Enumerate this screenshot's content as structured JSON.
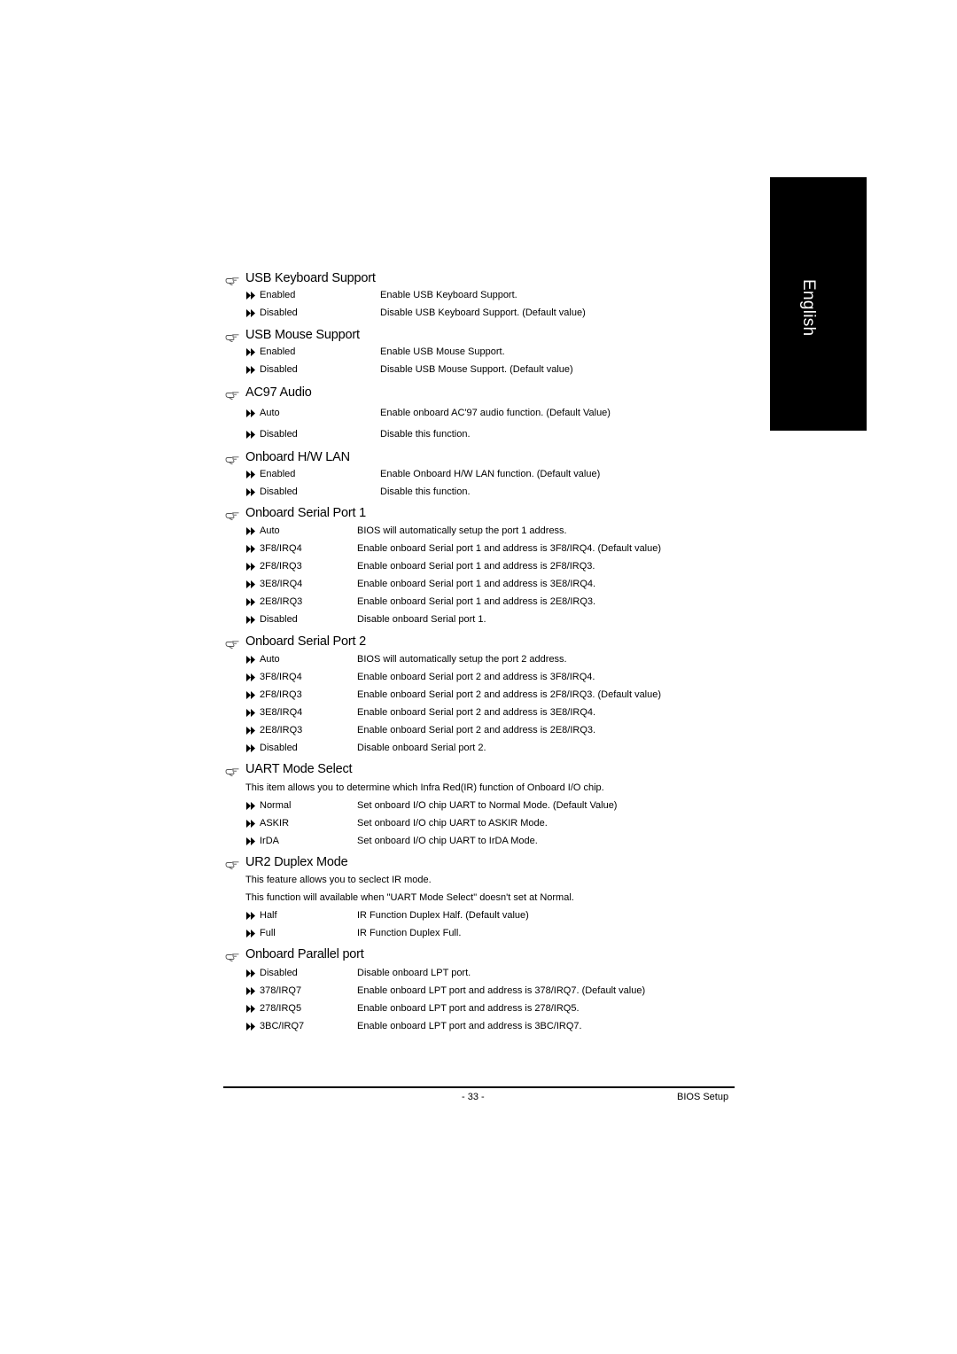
{
  "side_tab": {
    "label": "English"
  },
  "sections": [
    {
      "title": "USB Keyboard Support",
      "notes": [],
      "options": [
        {
          "name": "Enabled",
          "desc": "Enable USB Keyboard Support."
        },
        {
          "name": "Disabled",
          "desc": "Disable USB Keyboard Support. (Default value)"
        }
      ]
    },
    {
      "title": "USB Mouse Support",
      "notes": [],
      "options": [
        {
          "name": "Enabled",
          "desc": "Enable USB Mouse Support."
        },
        {
          "name": "Disabled",
          "desc": "Disable USB Mouse Support. (Default value)"
        }
      ]
    },
    {
      "title": "AC97 Audio",
      "notes": [],
      "options": [
        {
          "name": "Auto",
          "desc": "Enable onboard AC'97 audio function. (Default Value)"
        },
        {
          "name": "Disabled",
          "desc": "Disable this function."
        }
      ]
    },
    {
      "title": "Onboard H/W LAN",
      "notes": [],
      "options": [
        {
          "name": "Enabled",
          "desc": "Enable Onboard H/W LAN function. (Default value)"
        },
        {
          "name": "Disabled",
          "desc": "Disable this function."
        }
      ]
    },
    {
      "title": "Onboard Serial Port 1",
      "notes": [],
      "options": [
        {
          "name": "Auto",
          "desc": "BIOS will automatically setup the port 1 address."
        },
        {
          "name": "3F8/IRQ4",
          "desc": "Enable onboard Serial port 1 and address is 3F8/IRQ4. (Default value)"
        },
        {
          "name": "2F8/IRQ3",
          "desc": "Enable onboard Serial port 1 and address is 2F8/IRQ3."
        },
        {
          "name": "3E8/IRQ4",
          "desc": "Enable onboard Serial port 1 and address is 3E8/IRQ4."
        },
        {
          "name": "2E8/IRQ3",
          "desc": "Enable onboard Serial port 1 and address is 2E8/IRQ3."
        },
        {
          "name": "Disabled",
          "desc": "Disable onboard Serial port 1."
        }
      ]
    },
    {
      "title": "Onboard Serial Port 2",
      "notes": [],
      "options": [
        {
          "name": "Auto",
          "desc": "BIOS will automatically setup the port 2 address."
        },
        {
          "name": "3F8/IRQ4",
          "desc": "Enable onboard Serial port 2 and address is 3F8/IRQ4."
        },
        {
          "name": "2F8/IRQ3",
          "desc": "Enable onboard Serial port 2 and address is 2F8/IRQ3. (Default value)"
        },
        {
          "name": "3E8/IRQ4",
          "desc": "Enable onboard Serial port 2 and address is 3E8/IRQ4."
        },
        {
          "name": "2E8/IRQ3",
          "desc": "Enable onboard Serial port 2 and address is 2E8/IRQ3."
        },
        {
          "name": "Disabled",
          "desc": "Disable onboard Serial port 2."
        }
      ]
    },
    {
      "title": "UART Mode Select",
      "notes": [
        "This item allows you to determine which Infra Red(IR) function of Onboard I/O chip."
      ],
      "options": [
        {
          "name": "Normal",
          "desc": "Set onboard I/O chip UART to Normal Mode. (Default Value)"
        },
        {
          "name": "ASKIR",
          "desc": "Set onboard I/O chip UART to ASKIR Mode."
        },
        {
          "name": "IrDA",
          "desc": "Set onboard I/O chip UART to IrDA Mode."
        }
      ]
    },
    {
      "title": "UR2 Duplex Mode",
      "notes": [
        "This feature allows you to seclect IR mode.",
        "This function will available when \"UART Mode Select\" doesn't set at Normal."
      ],
      "options": [
        {
          "name": "Half",
          "desc": "IR Function Duplex Half. (Default value)"
        },
        {
          "name": "Full",
          "desc": "IR Function Duplex Full."
        }
      ]
    },
    {
      "title": "Onboard Parallel port",
      "notes": [],
      "options": [
        {
          "name": "Disabled",
          "desc": "Disable onboard LPT port."
        },
        {
          "name": "378/IRQ7",
          "desc": "Enable onboard LPT port and address is 378/IRQ7. (Default value)"
        },
        {
          "name": "278/IRQ5",
          "desc": "Enable onboard LPT port and address is 278/IRQ5."
        },
        {
          "name": "3BC/IRQ7",
          "desc": "Enable onboard LPT port and address is 3BC/IRQ7."
        }
      ]
    }
  ],
  "footer": {
    "page_number": "- 33 -",
    "title": "BIOS Setup"
  }
}
